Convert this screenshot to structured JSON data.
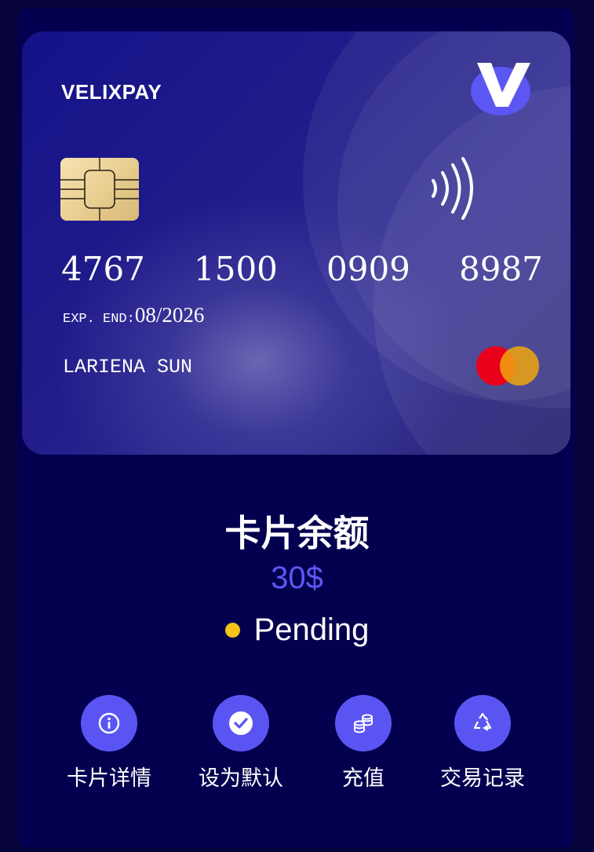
{
  "card": {
    "brand": "VELIXPAY",
    "number_groups": [
      "4767",
      "1500",
      "0909",
      "8987"
    ],
    "exp_label": "EXP. END:",
    "exp_value": "08/2026",
    "holder": "LARIENA SUN",
    "logo_icon": "velixpay-v-logo",
    "chip_icon": "chip-icon",
    "contactless_icon": "contactless-icon",
    "network_icon": "mastercard-logo"
  },
  "summary": {
    "title": "卡片余额",
    "balance": "30$",
    "status": "Pending",
    "status_color": "#f5c518"
  },
  "actions": [
    {
      "label": "卡片详情",
      "icon": "info-icon"
    },
    {
      "label": "设为默认",
      "icon": "check-icon"
    },
    {
      "label": "充值",
      "icon": "coins-icon"
    },
    {
      "label": "交易记录",
      "icon": "recycle-icon"
    }
  ],
  "colors": {
    "accent": "#5a55f2",
    "background": "#03004f"
  }
}
